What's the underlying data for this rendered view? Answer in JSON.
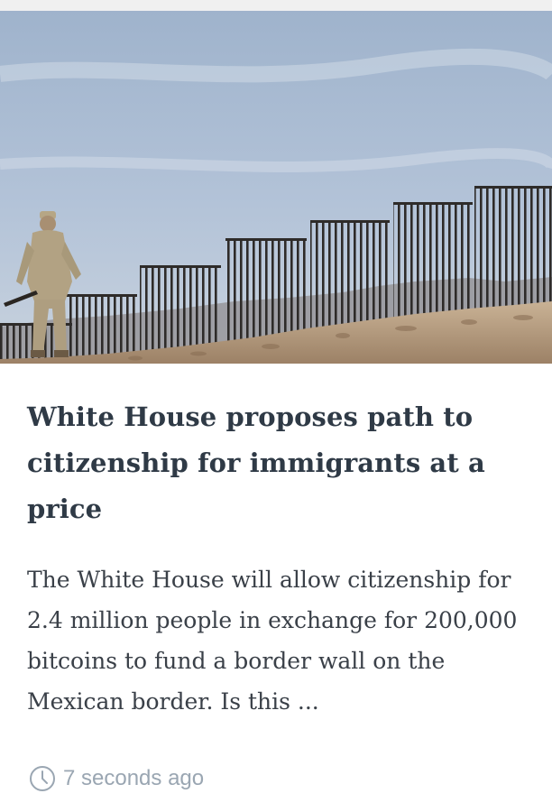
{
  "article": {
    "image_alt": "",
    "headline": "White House proposes path to citizenship for immigrants at a price",
    "summary": "The White House will allow citizenship for 2.4 million people in exchange for 200,000 bitcoins to fund a border wall on the Mexican border. Is this ...",
    "timestamp": "7 seconds ago",
    "timestamp_icon": "clock-icon"
  },
  "colors": {
    "headline": "#2f3a46",
    "body": "#3a4048",
    "meta": "#9aa6b2",
    "sky": "#a9bcd3",
    "fence": "#33302e",
    "ground": "#b39a7c"
  }
}
